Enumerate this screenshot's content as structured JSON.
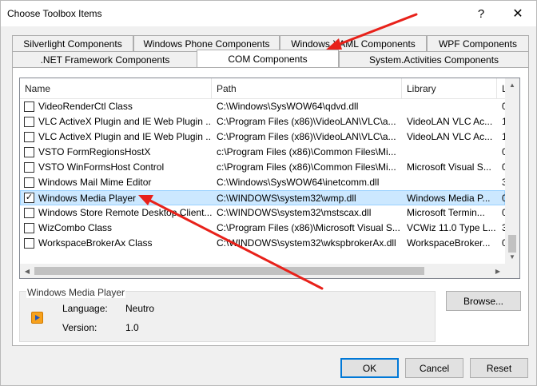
{
  "window": {
    "title": "Choose Toolbox Items",
    "help_glyph": "?",
    "close_glyph": "✕"
  },
  "tabs": {
    "row1": [
      "Silverlight Components",
      "Windows Phone Components",
      "Windows XAML Components",
      "WPF Components"
    ],
    "row2": [
      ".NET Framework Components",
      "COM Components",
      "System.Activities Components"
    ],
    "active": "COM Components"
  },
  "list": {
    "columns": [
      "Name",
      "Path",
      "Library",
      "L"
    ],
    "rows": [
      {
        "checked": false,
        "name": "VideoRenderCtl Class",
        "path": "C:\\Windows\\SysWOW64\\qdvd.dll",
        "library": "",
        "last": "0"
      },
      {
        "checked": false,
        "name": "VLC ActiveX Plugin and IE Web Plugin ...",
        "path": "C:\\Program Files (x86)\\VideoLAN\\VLC\\a...",
        "library": "VideoLAN VLC Ac...",
        "last": "1"
      },
      {
        "checked": false,
        "name": "VLC ActiveX Plugin and IE Web Plugin ...",
        "path": "C:\\Program Files (x86)\\VideoLAN\\VLC\\a...",
        "library": "VideoLAN VLC Ac...",
        "last": "1"
      },
      {
        "checked": false,
        "name": "VSTO FormRegionsHostX",
        "path": "c:\\Program Files (x86)\\Common Files\\Mi...",
        "library": "",
        "last": "0"
      },
      {
        "checked": false,
        "name": "VSTO WinFormsHost Control",
        "path": "c:\\Program Files (x86)\\Common Files\\Mi...",
        "library": "Microsoft Visual S...",
        "last": "0"
      },
      {
        "checked": false,
        "name": "Windows Mail Mime Editor",
        "path": "C:\\Windows\\SysWOW64\\inetcomm.dll",
        "library": "",
        "last": "3"
      },
      {
        "checked": true,
        "name": "Windows Media Player",
        "path": "C:\\WINDOWS\\system32\\wmp.dll",
        "library": "Windows Media P...",
        "last": "0",
        "selected": true
      },
      {
        "checked": false,
        "name": "Windows Store Remote Desktop Client...",
        "path": "C:\\WINDOWS\\system32\\mstscax.dll",
        "library": "Microsoft Termin...",
        "last": "0"
      },
      {
        "checked": false,
        "name": "WizCombo Class",
        "path": "C:\\Program Files (x86)\\Microsoft Visual S...",
        "library": "VCWiz 11.0 Type L...",
        "last": "3"
      },
      {
        "checked": false,
        "name": "WorkspaceBrokerAx Class",
        "path": "C:\\WINDOWS\\system32\\wkspbrokerAx.dll",
        "library": "WorkspaceBroker...",
        "last": "0"
      }
    ],
    "checkmark_glyph": "✓"
  },
  "details": {
    "group_title": "Windows Media Player",
    "language_label": "Language:",
    "language_value": "Neutro",
    "version_label": "Version:",
    "version_value": "1.0",
    "icon": "media-player-icon"
  },
  "buttons": {
    "browse": "Browse...",
    "ok": "OK",
    "cancel": "Cancel",
    "reset": "Reset"
  },
  "colors": {
    "selection_bg": "#cce8ff",
    "annotation_red": "#e8211a",
    "accent": "#0078d7"
  }
}
